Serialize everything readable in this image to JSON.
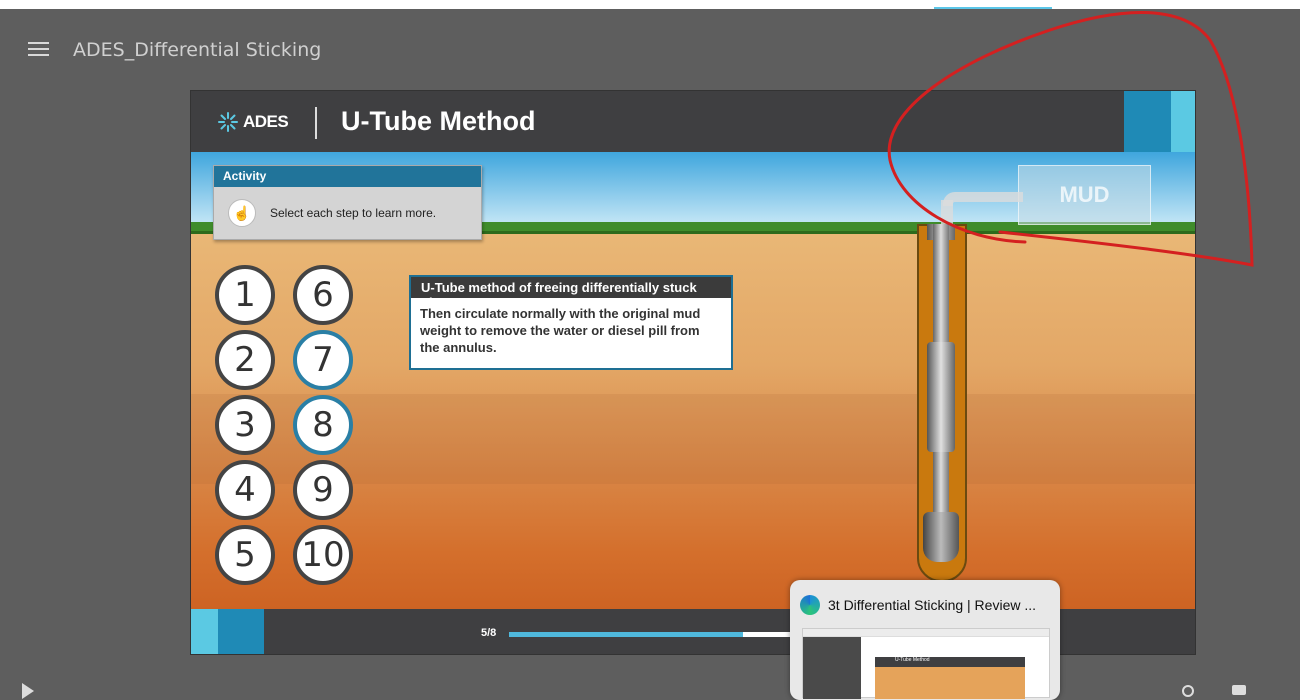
{
  "player": {
    "course_title": "ADES_Differential Sticking"
  },
  "slide": {
    "logo_text": "ADES",
    "title": "U-Tube Method",
    "activity": {
      "heading": "Activity",
      "instruction": "Select each step to learn more."
    },
    "steps": [
      {
        "label": "1",
        "visited": false
      },
      {
        "label": "2",
        "visited": false
      },
      {
        "label": "3",
        "visited": false
      },
      {
        "label": "4",
        "visited": false
      },
      {
        "label": "5",
        "visited": false
      },
      {
        "label": "6",
        "visited": false
      },
      {
        "label": "7",
        "visited": true
      },
      {
        "label": "8",
        "visited": true
      },
      {
        "label": "9",
        "visited": false
      },
      {
        "label": "10",
        "visited": false
      }
    ],
    "info_box": {
      "heading": "U-Tube method of freeing differentially stuck pipe",
      "body": "Then circulate normally with the original mud weight to remove the water or diesel pill from  the annulus."
    },
    "mud_label": "MUD",
    "footer": {
      "page_indicator": "5/8",
      "progress_fraction": 0.78
    }
  },
  "taskbar_preview": {
    "title": "3t Differential Sticking | Review ...",
    "thumb_slide_title": "U-Tube Method"
  },
  "colors": {
    "header_bg": "#3f3f41",
    "accent_blue": "#1f8ab6",
    "accent_light": "#5bc9e3",
    "activity_head": "#21749a",
    "annotation_red": "#d42020"
  }
}
